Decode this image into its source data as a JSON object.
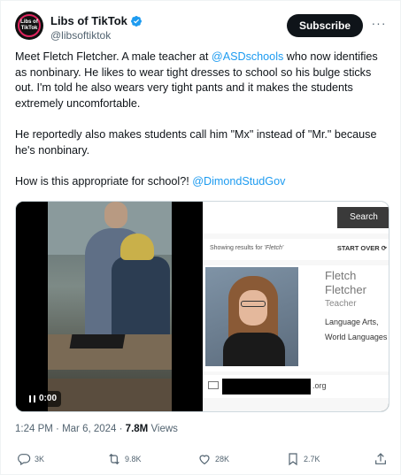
{
  "author": {
    "display_name": "Libs of TikTok",
    "handle": "@libsoftiktok",
    "avatar_text": "Libs of TikTok"
  },
  "header": {
    "subscribe_label": "Subscribe",
    "more_label": "···"
  },
  "tweet": {
    "paragraph_1_a": "Meet Fletch Fletcher. A male teacher at ",
    "paragraph_1_mention": "@ASDschools",
    "paragraph_1_b": " who now identifies as nonbinary. He likes to wear tight dresses to school so his bulge sticks out. I'm told he also wears very tight pants and it makes the students extremely uncomfortable.",
    "paragraph_2": "He reportedly also makes students call him \"Mx\" instead of \"Mr.\" because he's nonbinary.",
    "paragraph_3_a": "How is this appropriate for school?! ",
    "paragraph_3_mention": "@DimondStudGov"
  },
  "media": {
    "video_time": "0:00",
    "profile": {
      "search_label": "Search",
      "results_prefix": "Showing results for ",
      "results_query": "'Fletch'",
      "start_over": "START OVER",
      "first_name": "Fletch",
      "last_name": "Fletcher",
      "role": "Teacher",
      "subject_1": "Language Arts,",
      "subject_2": "World Languages",
      "email_suffix": ".org"
    }
  },
  "meta": {
    "time": "1:24 PM",
    "separator": " · ",
    "date": "Mar 6, 2024",
    "views_count": "7.8M",
    "views_label": " Views"
  },
  "actions": {
    "replies": "3K",
    "reposts": "9.8K",
    "likes": "28K",
    "bookmarks": "2.7K"
  },
  "colors": {
    "accent": "#1d9bf0",
    "text": "#0f1419",
    "secondary": "#536471"
  }
}
